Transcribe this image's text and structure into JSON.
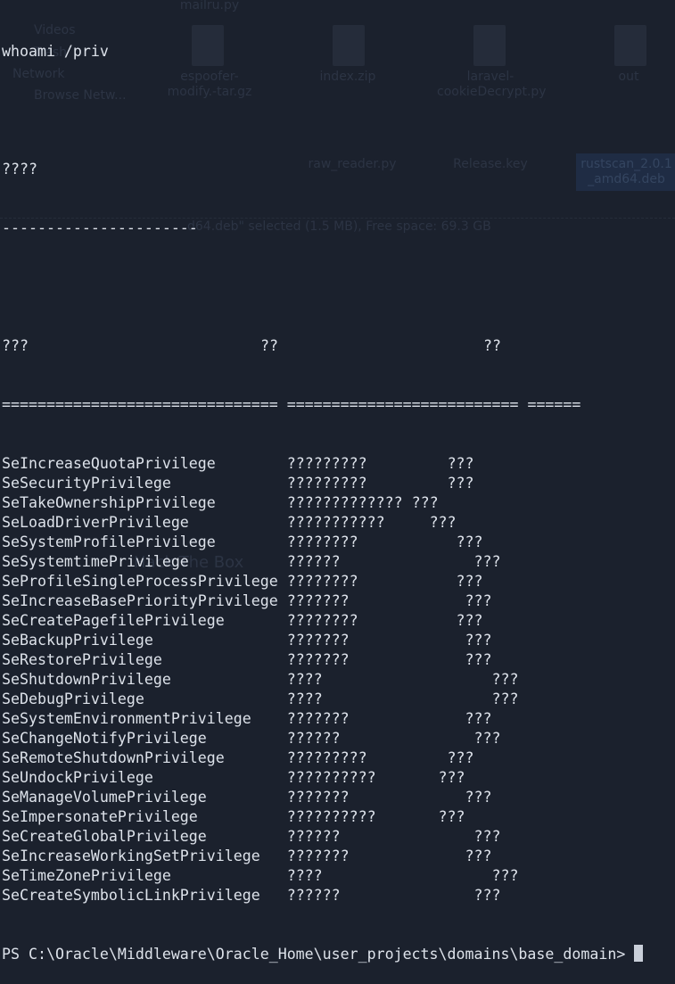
{
  "desktop": {
    "items": [
      "mailru.py",
      "Videos",
      "Trash",
      "Network",
      "Browse Netw...",
      "espoofer-modify.-tar.gz",
      "index.zip",
      "laravel-cookieDecrypt.py",
      "out",
      "raw_reader.py",
      "Release.key",
      "rustscan_2.0.1_amd64.deb",
      "Hack The Box"
    ],
    "status": "d64.deb\" selected (1.5 MB), Free space: 69.3 GB"
  },
  "terminal": {
    "command": "whoami /priv",
    "section_title": "????",
    "section_underline": "----------------------",
    "headers": [
      "???",
      "??",
      "??"
    ],
    "separators": [
      "===============================",
      "==========================",
      "======"
    ],
    "privileges": [
      {
        "name": "SeIncreaseQuotaPrivilege",
        "description": "?????????",
        "state": "???"
      },
      {
        "name": "SeSecurityPrivilege",
        "description": "?????????",
        "state": "???"
      },
      {
        "name": "SeTakeOwnershipPrivilege",
        "description": "?????????????",
        "state": "???"
      },
      {
        "name": "SeLoadDriverPrivilege",
        "description": "???????????",
        "state": "???"
      },
      {
        "name": "SeSystemProfilePrivilege",
        "description": "????????",
        "state": "???"
      },
      {
        "name": "SeSystemtimePrivilege",
        "description": "??????",
        "state": "???"
      },
      {
        "name": "SeProfileSingleProcessPrivilege",
        "description": "????????",
        "state": "???"
      },
      {
        "name": "SeIncreaseBasePriorityPrivilege",
        "description": "???????",
        "state": "???"
      },
      {
        "name": "SeCreatePagefilePrivilege",
        "description": "????????",
        "state": "???"
      },
      {
        "name": "SeBackupPrivilege",
        "description": "???????",
        "state": "???"
      },
      {
        "name": "SeRestorePrivilege",
        "description": "???????",
        "state": "???"
      },
      {
        "name": "SeShutdownPrivilege",
        "description": "????",
        "state": "???"
      },
      {
        "name": "SeDebugPrivilege",
        "description": "????",
        "state": "???"
      },
      {
        "name": "SeSystemEnvironmentPrivilege",
        "description": "???????",
        "state": "???"
      },
      {
        "name": "SeChangeNotifyPrivilege",
        "description": "??????",
        "state": "???"
      },
      {
        "name": "SeRemoteShutdownPrivilege",
        "description": "?????????",
        "state": "???"
      },
      {
        "name": "SeUndockPrivilege",
        "description": "??????????",
        "state": "???"
      },
      {
        "name": "SeManageVolumePrivilege",
        "description": "???????",
        "state": "???"
      },
      {
        "name": "SeImpersonatePrivilege",
        "description": "??????????",
        "state": "???"
      },
      {
        "name": "SeCreateGlobalPrivilege",
        "description": "??????",
        "state": "???"
      },
      {
        "name": "SeIncreaseWorkingSetPrivilege",
        "description": "???????",
        "state": "???"
      },
      {
        "name": "SeTimeZonePrivilege",
        "description": "????",
        "state": "???"
      },
      {
        "name": "SeCreateSymbolicLinkPrivilege",
        "description": "??????",
        "state": "???"
      }
    ],
    "prompt": "PS C:\\Oracle\\Middleware\\Oracle_Home\\user_projects\\domains\\base_domain> "
  }
}
